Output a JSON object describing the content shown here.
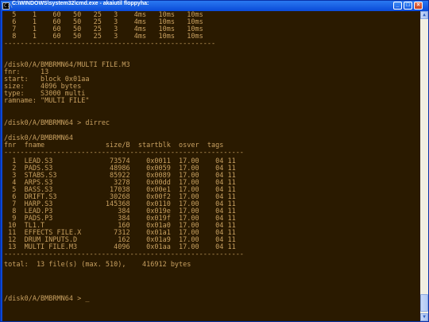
{
  "window": {
    "title": "C:\\WINDOWS\\system32\\cmd.exe - akaiutil floppyha:",
    "icon_text": "C:\\",
    "minimize_icon": "minimize-icon",
    "maximize_icon": "maximize-icon",
    "close_icon": "close-icon"
  },
  "console": {
    "lines": [
      "  5    1    60   50   25   3    4ms   10ms   10ms",
      "  6    1    60   50   25   3    4ms   10ms   10ms",
      "  7    1    60   50   25   3    4ms   10ms   10ms",
      "  8    1    60   50   25   3    4ms   10ms   10ms",
      "----------------------------------------------------",
      "",
      "/disk0/A/BMBRMN64/MULTI FILE.M3",
      "fnr:     13",
      "start:   block 0x01aa",
      "size:    4096 bytes",
      "type:    S3000 multi",
      "ramname: \"MULTI FILE\"",
      "",
      "/disk0/A/BMBRMN64 > dirrec",
      "",
      "/disk0/A/BMBRMN64",
      "fnr  fname               size/B  startblk  osver  tags",
      "-----------------------------------------------------------",
      "  1  LEAD.S3              73574    0x0011  17.00    04 11",
      "  2  PADS.S3              48986    0x0059  17.00    04 11",
      "  3  STABS.S3             85922    0x0089  17.00    04 11",
      "  4  ARPS.S3               3278    0x00dd  17.00    04 11",
      "  5  BASS.S3              17038    0x00e1  17.00    04 11",
      "  6  DRIFT.S3             30268    0x00f2  17.00    04 11",
      "  7  HARP.S3             145368    0x0110  17.00    04 11",
      "  8  LEAD.P3                384    0x019e  17.00    04 11",
      "  9  PADS.P3                384    0x019f  17.00    04 11",
      " 10  TL1.T                  160    0x01a0  17.00    04 11",
      " 11  EFFECTS FILE.X        7312    0x01a1  17.00    04 11",
      " 12  DRUM INPUTS.D          162    0x01a9  17.00    04 11",
      " 13  MULTI FILE.M3         4096    0x01aa  17.00    04 11",
      "-----------------------------------------------------------",
      "total:  13 file(s) (max. 510),    416912 bytes",
      "",
      "",
      "/disk0/A/BMBRMN64 > _"
    ]
  },
  "scrollbar": {
    "up_icon": "scroll-up-arrow-icon",
    "down_icon": "scroll-down-arrow-icon"
  }
}
